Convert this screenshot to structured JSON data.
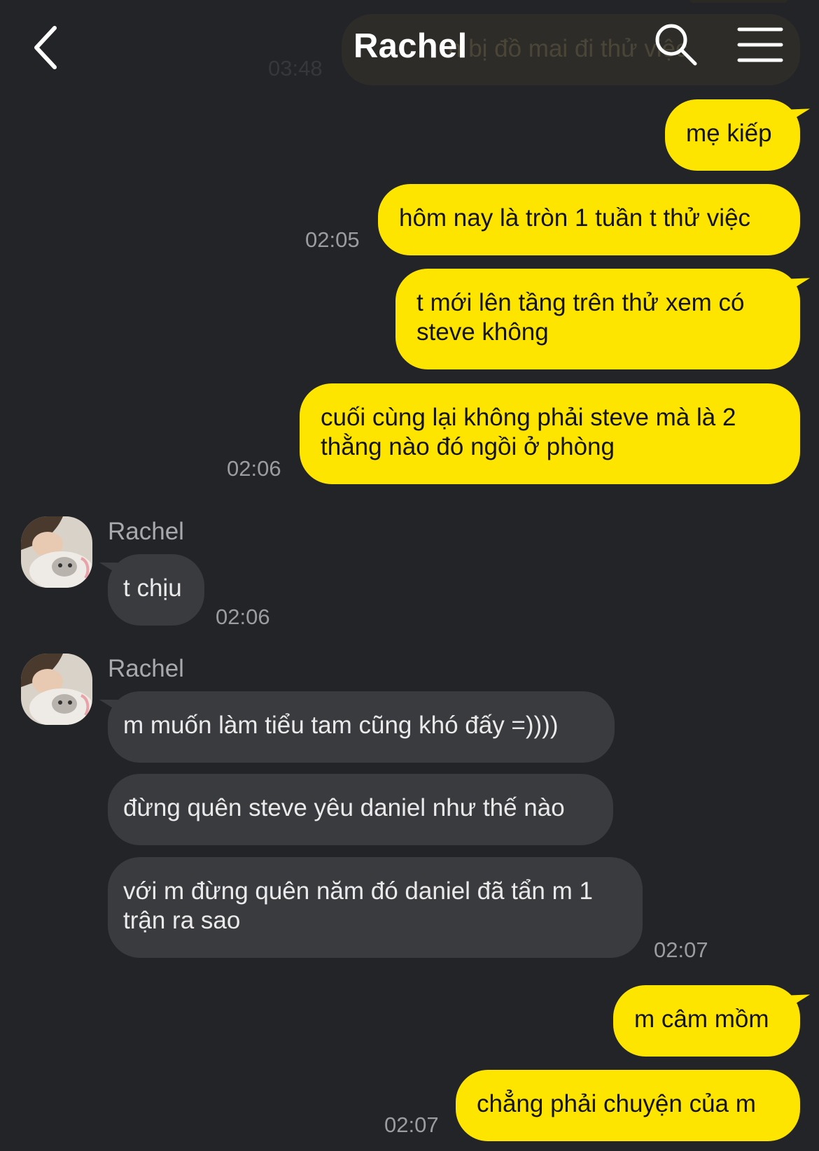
{
  "header": {
    "title": "Rachel",
    "ghost_text": "n bị đồ mai đi thử việc",
    "ghost_time": "03:48"
  },
  "messages": {
    "m1": "mẹ kiếp",
    "m2": "hôm nay là tròn 1 tuần t thử việc",
    "m3_line1": "t mới lên tầng trên thử xem có",
    "m3_line2": "steve không",
    "m4_line1": "cuối cùng lại không phải steve mà là 2",
    "m4_line2": "thằng nào đó ngồi ở phòng",
    "r1": "t chịu",
    "r2": "m muốn làm tiểu tam cũng khó đấy =))))",
    "r3": "đừng quên steve yêu daniel như thế nào",
    "r4_line1": "với m đừng quên năm đó daniel đã tẩn m 1",
    "r4_line2": "trận ra sao",
    "m5": "m câm mồm",
    "m6": "chẳng phải chuyện của m"
  },
  "times": {
    "t1": "02:05",
    "t2": "02:06",
    "t3": "02:06",
    "t4": "02:07",
    "t5": "02:07"
  },
  "senders": {
    "s1": "Rachel",
    "s2": "Rachel"
  },
  "colors": {
    "background": "#232427",
    "outgoing_bubble": "#fee500",
    "incoming_bubble": "#3a3b3e",
    "timestamp": "#9b9c9f"
  },
  "icons": {
    "back": "chevron-left-icon",
    "search": "search-icon",
    "menu": "hamburger-menu-icon"
  }
}
